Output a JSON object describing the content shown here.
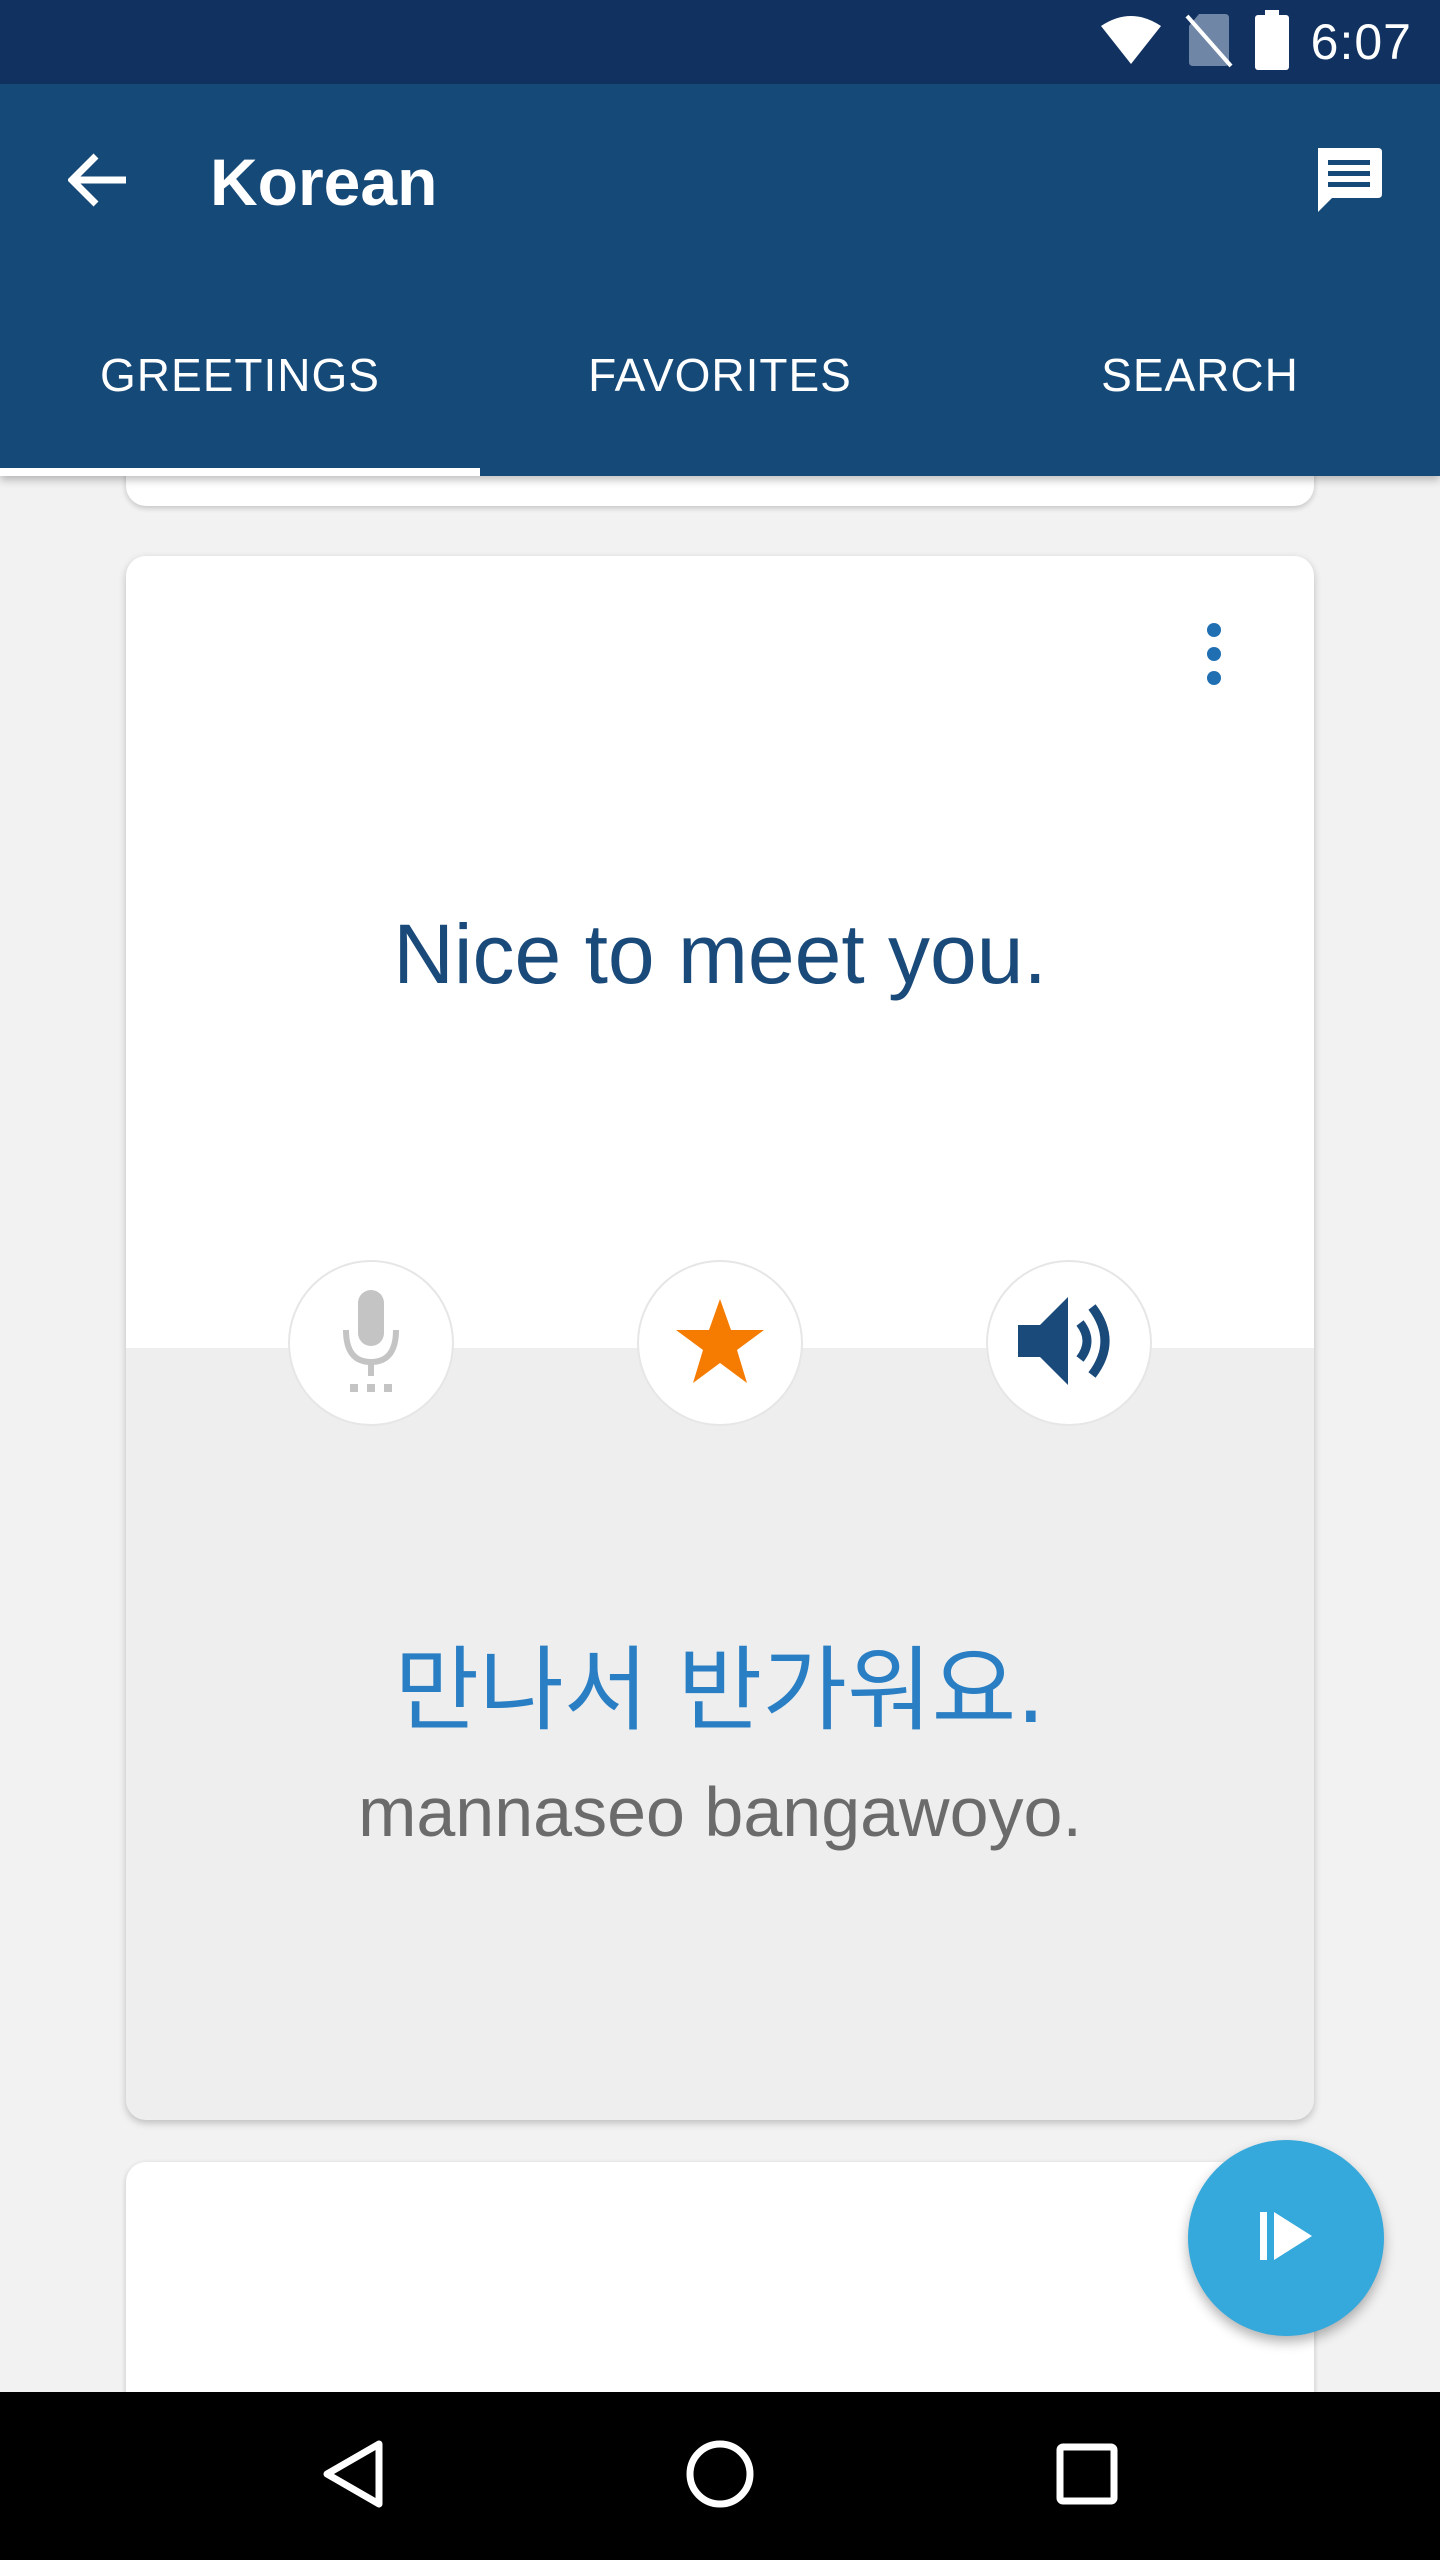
{
  "status_bar": {
    "time": "6:07",
    "icons": [
      "wifi-icon",
      "no-sim-icon",
      "battery-icon"
    ]
  },
  "app_bar": {
    "title": "Korean",
    "back_icon": "arrow-left-icon",
    "action_icon": "chat-icon"
  },
  "tabs": [
    {
      "label": "GREETINGS",
      "active": true
    },
    {
      "label": "FAVORITES",
      "active": false
    },
    {
      "label": "SEARCH",
      "active": false
    }
  ],
  "card": {
    "phrase": "Nice to meet you.",
    "translation": "만나서 반가워요.",
    "romanization": "mannaseo bangawoyo.",
    "actions": [
      "microphone-icon",
      "star-icon",
      "speaker-icon"
    ],
    "favorite": true
  },
  "fab": {
    "icon": "play-icon"
  },
  "navigation": [
    "back-triangle-icon",
    "home-circle-icon",
    "recents-square-icon"
  ],
  "colors": {
    "status_bar": "#113260",
    "app_bar": "#154978",
    "phrase_text": "#1a4a7a",
    "translation_text": "#2a7fc4",
    "star": "#f57c00",
    "fab": "#35a8dc"
  }
}
